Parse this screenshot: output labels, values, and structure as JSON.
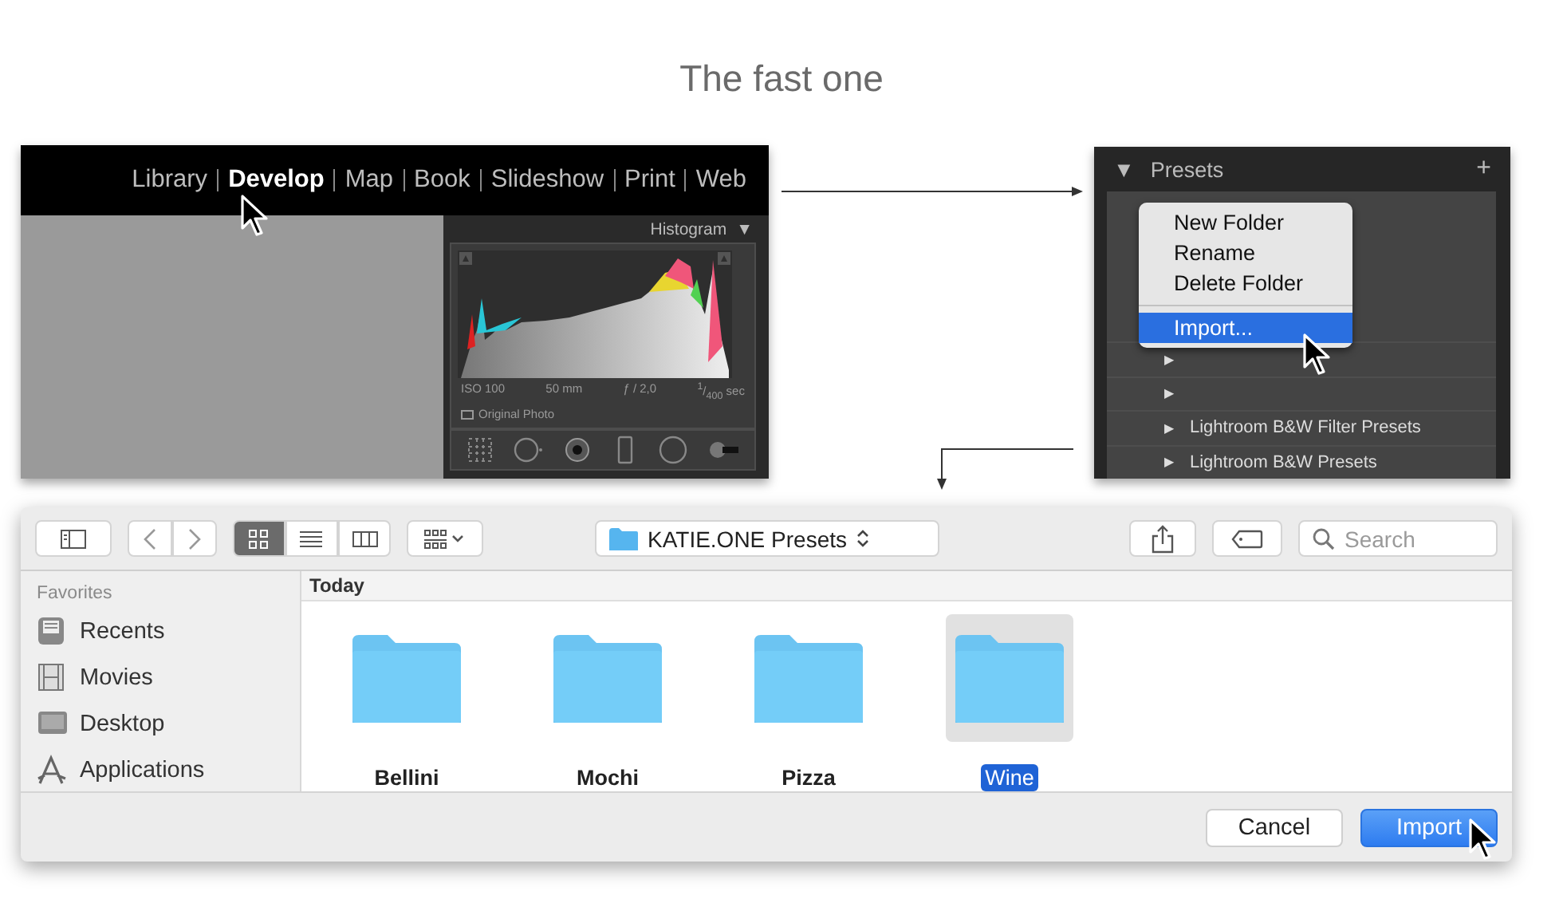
{
  "title": "The fast one",
  "develop_panel": {
    "modules": [
      {
        "label": "Library",
        "selected": false
      },
      {
        "label": "Develop",
        "selected": true
      },
      {
        "label": "Map",
        "selected": false
      },
      {
        "label": "Book",
        "selected": false
      },
      {
        "label": "Slideshow",
        "selected": false
      },
      {
        "label": "Print",
        "selected": false
      },
      {
        "label": "Web",
        "selected": false
      }
    ],
    "histogram": {
      "title": "Histogram",
      "toggle": "▼",
      "exif": [
        "ISO 100",
        "50 mm",
        "ƒ / 2,0",
        "$^{1}$/$_{400}$ sec"
      ],
      "original_photo": {
        "label": "Original Photo",
        "checked": false
      }
    }
  },
  "presets_panel": {
    "toggle": "▼",
    "title": "Presets",
    "add": "+",
    "context_menu": [
      {
        "label": "New Folder",
        "selected": false
      },
      {
        "label": "Rename",
        "selected": false
      },
      {
        "label": "Delete Folder",
        "selected": false
      },
      {
        "label": "Import...",
        "selected": true
      }
    ],
    "rows": [
      {
        "expander": "▶"
      },
      {
        "expander": "▶"
      },
      {
        "expander": "▶",
        "label": "Lightroom B&W Filter Presets"
      },
      {
        "expander": "▶",
        "label": "Lightroom B&W Presets"
      }
    ]
  },
  "dialog": {
    "view_modes": [
      {
        "kind": "icons",
        "selected": true
      },
      {
        "kind": "list",
        "selected": false
      },
      {
        "kind": "columns",
        "selected": false
      }
    ],
    "path": "KATIE.ONE Presets",
    "search": {
      "placeholder": "Search"
    },
    "sidebar": {
      "heading": "Favorites",
      "items": [
        {
          "kind": "recents",
          "label": "Recents"
        },
        {
          "kind": "movies",
          "label": "Movies"
        },
        {
          "kind": "desktop",
          "label": "Desktop"
        },
        {
          "kind": "applications",
          "label": "Applications"
        }
      ]
    },
    "section": "Today",
    "files": [
      {
        "name": "Bellini",
        "selected": false
      },
      {
        "name": "Mochi",
        "selected": false
      },
      {
        "name": "Pizza",
        "selected": false
      },
      {
        "name": "Wine",
        "selected": true
      }
    ],
    "buttons": [
      {
        "label": "Cancel",
        "default": false
      },
      {
        "label": "Import",
        "default": true
      }
    ]
  }
}
